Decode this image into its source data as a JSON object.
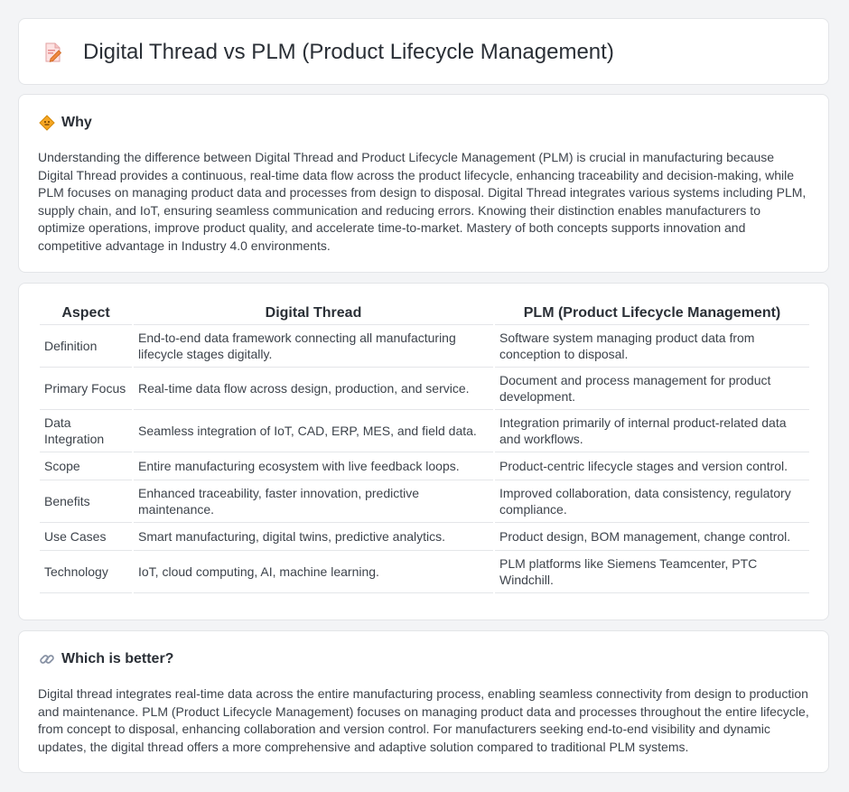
{
  "page": {
    "title": "Digital Thread vs PLM (Product Lifecycle Management)"
  },
  "why": {
    "heading": "Why",
    "text": "Understanding the difference between Digital Thread and Product Lifecycle Management (PLM) is crucial in manufacturing because Digital Thread provides a continuous, real-time data flow across the product lifecycle, enhancing traceability and decision-making, while PLM focuses on managing product data and processes from design to disposal. Digital Thread integrates various systems including PLM, supply chain, and IoT, ensuring seamless communication and reducing errors. Knowing their distinction enables manufacturers to optimize operations, improve product quality, and accelerate time-to-market. Mastery of both concepts supports innovation and competitive advantage in Industry 4.0 environments."
  },
  "comparison": {
    "headers": [
      "Aspect",
      "Digital Thread",
      "PLM (Product Lifecycle Management)"
    ],
    "rows": [
      [
        "Definition",
        "End-to-end data framework connecting all manufacturing lifecycle stages digitally.",
        "Software system managing product data from conception to disposal."
      ],
      [
        "Primary Focus",
        "Real-time data flow across design, production, and service.",
        "Document and process management for product development."
      ],
      [
        "Data Integration",
        "Seamless integration of IoT, CAD, ERP, MES, and field data.",
        "Integration primarily of internal product-related data and workflows."
      ],
      [
        "Scope",
        "Entire manufacturing ecosystem with live feedback loops.",
        "Product-centric lifecycle stages and version control."
      ],
      [
        "Benefits",
        "Enhanced traceability, faster innovation, predictive maintenance.",
        "Improved collaboration, data consistency, regulatory compliance."
      ],
      [
        "Use Cases",
        "Smart manufacturing, digital twins, predictive analytics.",
        "Product design, BOM management, change control."
      ],
      [
        "Technology",
        "IoT, cloud computing, AI, machine learning.",
        "PLM platforms like Siemens Teamcenter, PTC Windchill."
      ]
    ]
  },
  "better": {
    "heading": "Which is better?",
    "text": "Digital thread integrates real-time data across the entire manufacturing process, enabling seamless connectivity from design to production and maintenance. PLM (Product Lifecycle Management) focuses on managing product data and processes throughout the entire lifecycle, from concept to disposal, enhancing collaboration and version control. For manufacturers seeking end-to-end visibility and dynamic updates, the digital thread offers a more comprehensive and adaptive solution compared to traditional PLM systems."
  },
  "icons": {
    "title": "document-pencil-icon",
    "why": "diamond-warning-icon",
    "better": "link-icon"
  }
}
